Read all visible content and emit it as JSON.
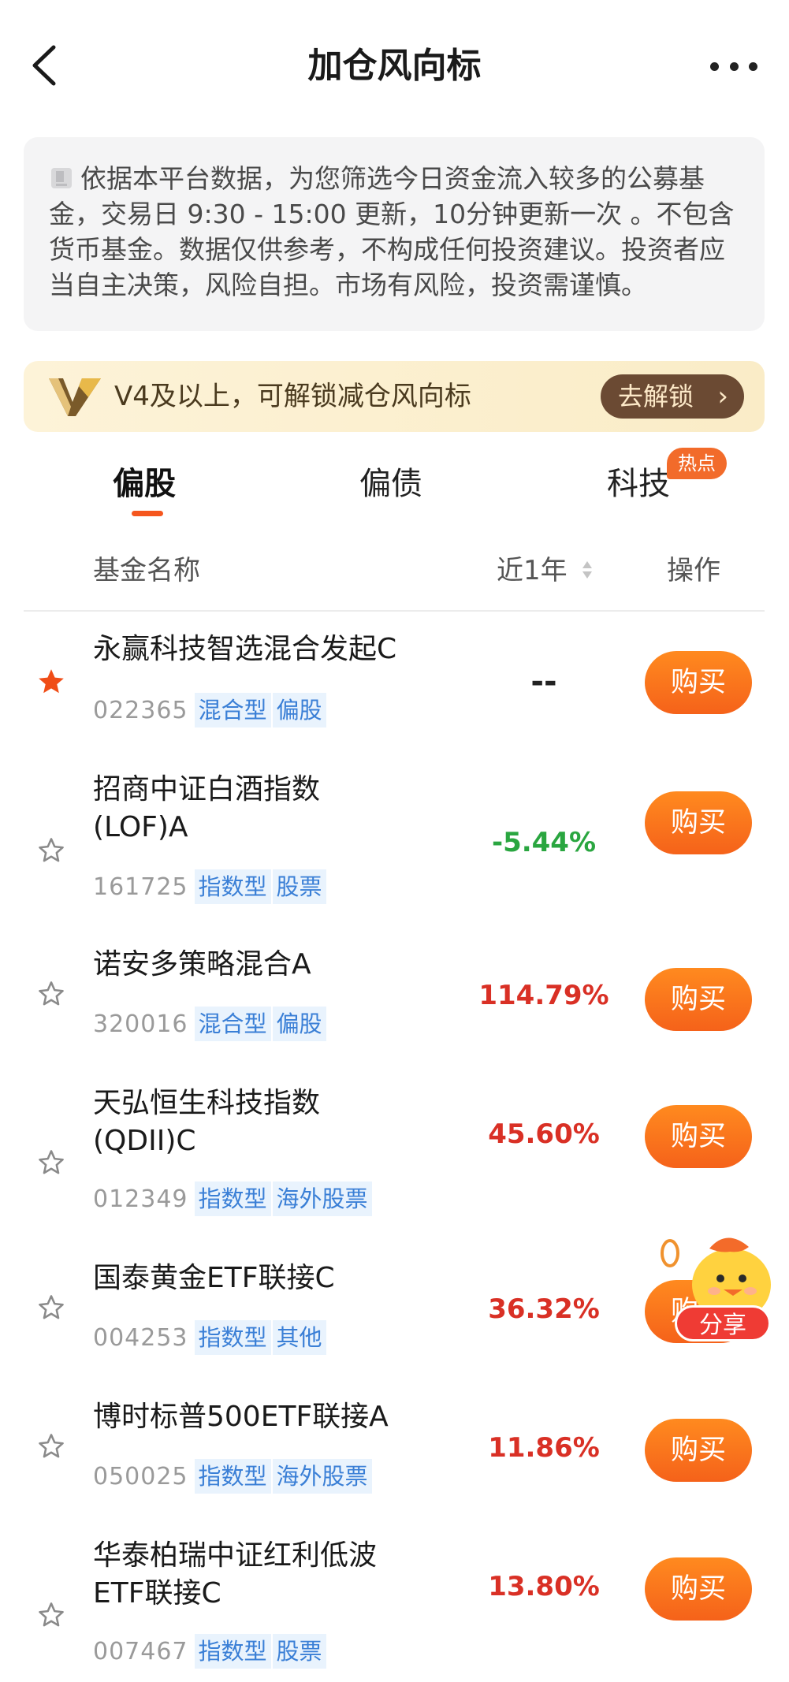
{
  "header": {
    "title": "加仓风向标"
  },
  "notice": {
    "text": "依据本平台数据，为您筛选今日资金流入较多的公募基金，交易日 9:30 - 15:00 更新，10分钟更新一次 。不包含货币基金。数据仅供参考，不构成任何投资建议。投资者应当自主决策，风险自担。市场有风险，投资需谨慎。"
  },
  "unlock": {
    "text": "V4及以上，可解锁减仓风向标",
    "button": "去解锁"
  },
  "tabs": [
    {
      "label": "偏股",
      "active": true
    },
    {
      "label": "偏债",
      "active": false
    },
    {
      "label": "科技",
      "active": false,
      "badge": "热点"
    }
  ],
  "table": {
    "col_name": "基金名称",
    "col_return": "近1年",
    "col_action": "操作"
  },
  "funds": [
    {
      "name": "永赢科技智选混合发起C",
      "code": "022365",
      "tags": [
        "混合型",
        "偏股"
      ],
      "return": "--",
      "starred": true,
      "buy": "购买"
    },
    {
      "name": "招商中证白酒指数(LOF)A",
      "name_line1": "招商中证白酒指数",
      "name_line2": "(LOF)A",
      "code": "161725",
      "tags": [
        "指数型",
        "股票"
      ],
      "return": "-5.44%",
      "starred": false,
      "buy": "购买"
    },
    {
      "name": "诺安多策略混合A",
      "code": "320016",
      "tags": [
        "混合型",
        "偏股"
      ],
      "return": "114.79%",
      "starred": false,
      "buy": "购买"
    },
    {
      "name": "天弘恒生科技指数(QDII)C",
      "name_line1": "天弘恒生科技指数",
      "name_line2": "(QDII)C",
      "code": "012349",
      "tags": [
        "指数型",
        "海外股票"
      ],
      "return": "45.60%",
      "starred": false,
      "buy": "购买"
    },
    {
      "name": "国泰黄金ETF联接C",
      "code": "004253",
      "tags": [
        "指数型",
        "其他"
      ],
      "return": "36.32%",
      "starred": false,
      "buy": "购买"
    },
    {
      "name": "博时标普500ETF联接A",
      "code": "050025",
      "tags": [
        "指数型",
        "海外股票"
      ],
      "return": "11.86%",
      "starred": false,
      "buy": "购买"
    },
    {
      "name": "华泰柏瑞中证红利低波ETF联接C",
      "name_line1": "华泰柏瑞中证红利低波",
      "name_line2": "ETF联接C",
      "code": "007467",
      "tags": [
        "指数型",
        "股票"
      ],
      "return": "13.80%",
      "starred": false,
      "buy": "购买"
    }
  ],
  "share": {
    "label": "分享"
  },
  "colors": {
    "accent": "#f5621a",
    "up": "#d93025",
    "down": "#2aa640",
    "tag_text": "#3a7fd6",
    "tag_bg": "#e9f3fd"
  },
  "icons": {
    "back": "chevron-left-icon",
    "more": "more-dots-icon",
    "star": "star-icon",
    "sort": "sort-icon",
    "notice": "document-icon",
    "vip": "v-logo-icon"
  }
}
